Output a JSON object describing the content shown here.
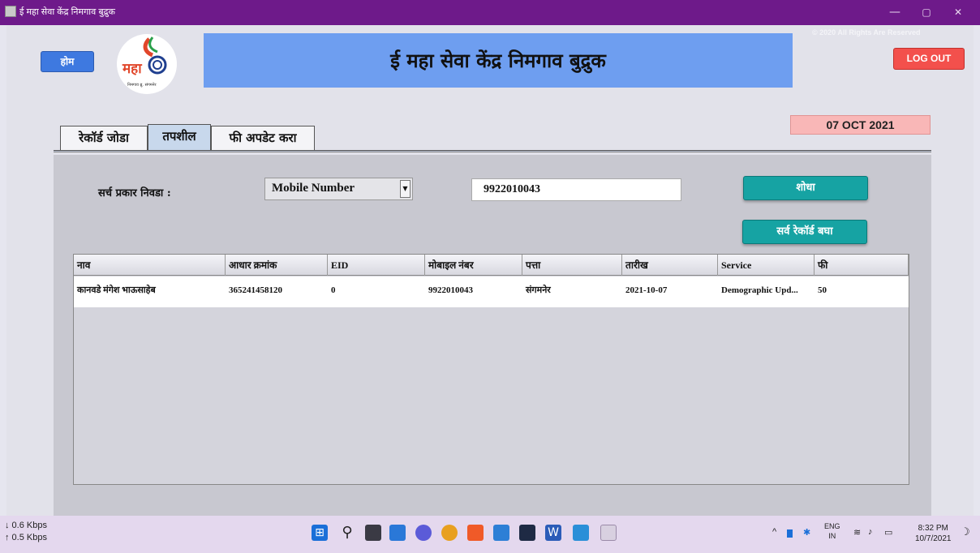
{
  "window": {
    "title": "ई महा सेवा केंद्र निमगाव बुद्रुक",
    "minimize": "—",
    "maximize": "▢",
    "close": "✕"
  },
  "header": {
    "home_label": "होम",
    "logo_text": "महा",
    "logo_subtext": "निमगाव ब्रु. संगमनेर",
    "banner_title": "ई महा सेवा केंद्र निमगाव बुद्रुक",
    "copyright": "© 2020 All Rights Are Reserved",
    "logout_label": "LOG OUT",
    "date": "07 OCT 2021"
  },
  "tabs": [
    {
      "label": "रेकॉर्ड जोडा",
      "active": false
    },
    {
      "label": "तपशील",
      "active": true
    },
    {
      "label": "फी अपडेट करा",
      "active": false
    }
  ],
  "search": {
    "type_label": "सर्च प्रकार निवडा :",
    "type_value": "Mobile Number",
    "query_value": "9922010043",
    "search_button": "शोधा",
    "all_records_button": "सर्व रेकॉर्ड बघा"
  },
  "table": {
    "columns": [
      "नाव",
      "आधार क्रमांक",
      "EID",
      "मोबाइल नंबर",
      "पत्ता",
      "तारीख",
      "Service",
      "फी"
    ],
    "rows": [
      [
        "कानवडे मंगेश भाऊसाहेब",
        "365241458120",
        "0",
        "9922010043",
        "संगमनेर",
        "2021-10-07",
        "Demographic Upd...",
        "50"
      ]
    ]
  },
  "taskbar": {
    "download_speed": "↓ 0.6 Kbps",
    "upload_speed": "↑ 0.5 Kbps",
    "lang_top": "ENG",
    "lang_bottom": "IN",
    "time": "8:32 PM",
    "date": "10/7/2021"
  },
  "colors": {
    "titlebar": "#6e1a8a",
    "banner": "#6e9ef0",
    "home_button": "#3e79e0",
    "logout_button": "#f3504c",
    "action_button": "#16a3a3",
    "date_box": "#f9b7b7"
  }
}
